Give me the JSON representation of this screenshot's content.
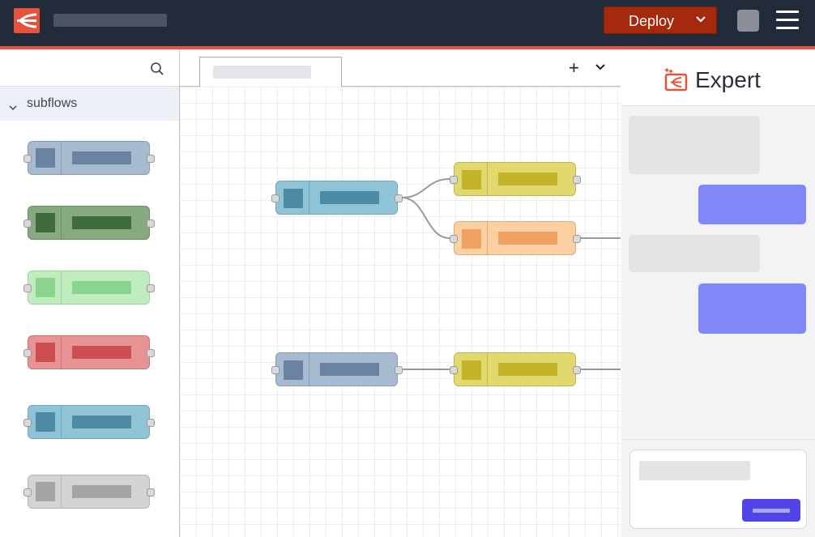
{
  "header": {
    "deploy_label": "Deploy",
    "colors": {
      "background": "#212b3a",
      "accent_line": "#e8504a",
      "deploy": "#a7290d"
    },
    "icons": {
      "logo": "node-red-logo",
      "deploy_menu": "chevron-down-icon",
      "main_menu": "hamburger-menu-icon",
      "user": "user-avatar-icon"
    }
  },
  "palette": {
    "search_icon": "search-icon",
    "category": {
      "label": "subflows",
      "expanded": true
    },
    "nodes": [
      {
        "fill": "#a6bbcf",
        "dark": "#6b83a3",
        "border": "#8a9bb5"
      },
      {
        "fill": "#87a980",
        "dark": "#3f6b3a",
        "border": "#6d8f66"
      },
      {
        "fill": "#c0edc0",
        "dark": "#8cd38c",
        "border": "#9fd09f"
      },
      {
        "fill": "#e79394",
        "dark": "#cc4e50",
        "border": "#c97475"
      },
      {
        "fill": "#8fc3d6",
        "dark": "#4d8aa3",
        "border": "#74a9bd"
      },
      {
        "fill": "#d4d4d4",
        "dark": "#a4a4a4",
        "border": "#b5b5b5"
      }
    ]
  },
  "workspace": {
    "tab_actions": {
      "add": "+",
      "menu_icon": "chevron-down-icon"
    },
    "flow_nodes": [
      {
        "id": "n1",
        "fill": "#8fc3d6",
        "dark": "#4d8aa3",
        "border": "#74a9bd"
      },
      {
        "id": "n2",
        "fill": "#e2d96e",
        "dark": "#c3b42a",
        "border": "#bdb55a"
      },
      {
        "id": "n3",
        "fill": "#fdd0a2",
        "dark": "#f0a060",
        "border": "#d8ac82"
      },
      {
        "id": "n4",
        "fill": "#a6bbcf",
        "dark": "#6b83a3",
        "border": "#8a9bb5"
      },
      {
        "id": "n5",
        "fill": "#e2d96e",
        "dark": "#c3b42a",
        "border": "#bdb55a"
      }
    ],
    "wires": [
      {
        "from": "n1",
        "to": "n2"
      },
      {
        "from": "n1",
        "to": "n3"
      },
      {
        "from": "n4",
        "to": "n5"
      },
      {
        "from": "n3",
        "to": "offscreen"
      },
      {
        "from": "n5",
        "to": "offscreen"
      }
    ]
  },
  "expert": {
    "title": "Expert",
    "icon": "expert-sparkle-icon",
    "colors": {
      "assistant_msg": "#e3e4e6",
      "user_msg": "#8187f7",
      "send": "#5145e8"
    }
  }
}
